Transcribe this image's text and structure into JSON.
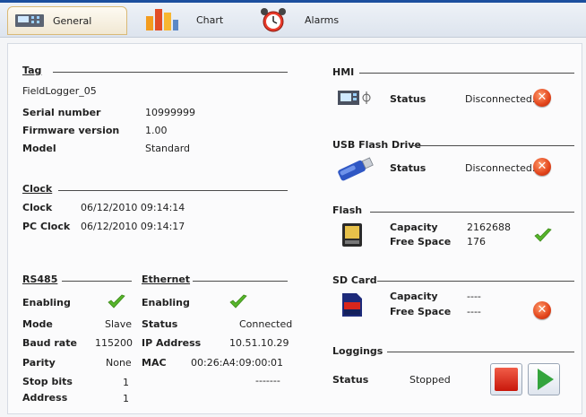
{
  "tabs": {
    "general": "General",
    "chart": "Chart",
    "alarms": "Alarms"
  },
  "tag": {
    "header": "Tag",
    "name": "FieldLogger_05",
    "serial_label": "Serial number",
    "serial_value": "10999999",
    "firmware_label": "Firmware version",
    "firmware_value": "1.00",
    "model_label": "Model",
    "model_value": "Standard"
  },
  "clock": {
    "header": "Clock",
    "clock_label": "Clock",
    "clock_value": "06/12/2010 09:14:14",
    "pc_clock_label": "PC Clock",
    "pc_clock_value": "06/12/2010 09:14:17"
  },
  "rs485": {
    "header": "RS485",
    "enabling_label": "Enabling",
    "mode_label": "Mode",
    "mode_value": "Slave",
    "baud_label": "Baud rate",
    "baud_value": "115200",
    "parity_label": "Parity",
    "parity_value": "None",
    "stopbits_label": "Stop bits",
    "stopbits_value": "1",
    "address_label": "Address",
    "address_value": "1"
  },
  "ethernet": {
    "header": "Ethernet",
    "enabling_label": "Enabling",
    "status_label": "Status",
    "status_value": "Connected",
    "ip_label": "IP Address",
    "ip_value": "10.51.10.29",
    "mac_label": "MAC",
    "mac_value": "00:26:A4:09:00:01",
    "extra_value": "-------"
  },
  "hmi": {
    "header": "HMI",
    "status_label": "Status",
    "status_value": "Disconnected."
  },
  "usb": {
    "header": "USB Flash Drive",
    "status_label": "Status",
    "status_value": "Disconnected."
  },
  "flash": {
    "header": "Flash",
    "capacity_label": "Capacity",
    "capacity_value": "2162688",
    "free_label": "Free Space",
    "free_value": "176"
  },
  "sdcard": {
    "header": "SD Card",
    "capacity_label": "Capacity",
    "capacity_value": "----",
    "free_label": "Free Space",
    "free_value": "----"
  },
  "loggings": {
    "header": "Loggings",
    "status_label": "Status",
    "status_value": "Stopped"
  },
  "colors": {
    "accent": "#1c4f9e",
    "check": "#57b52b",
    "error": "#e2441b",
    "stop": "#c8170b",
    "play": "#34a43d"
  }
}
